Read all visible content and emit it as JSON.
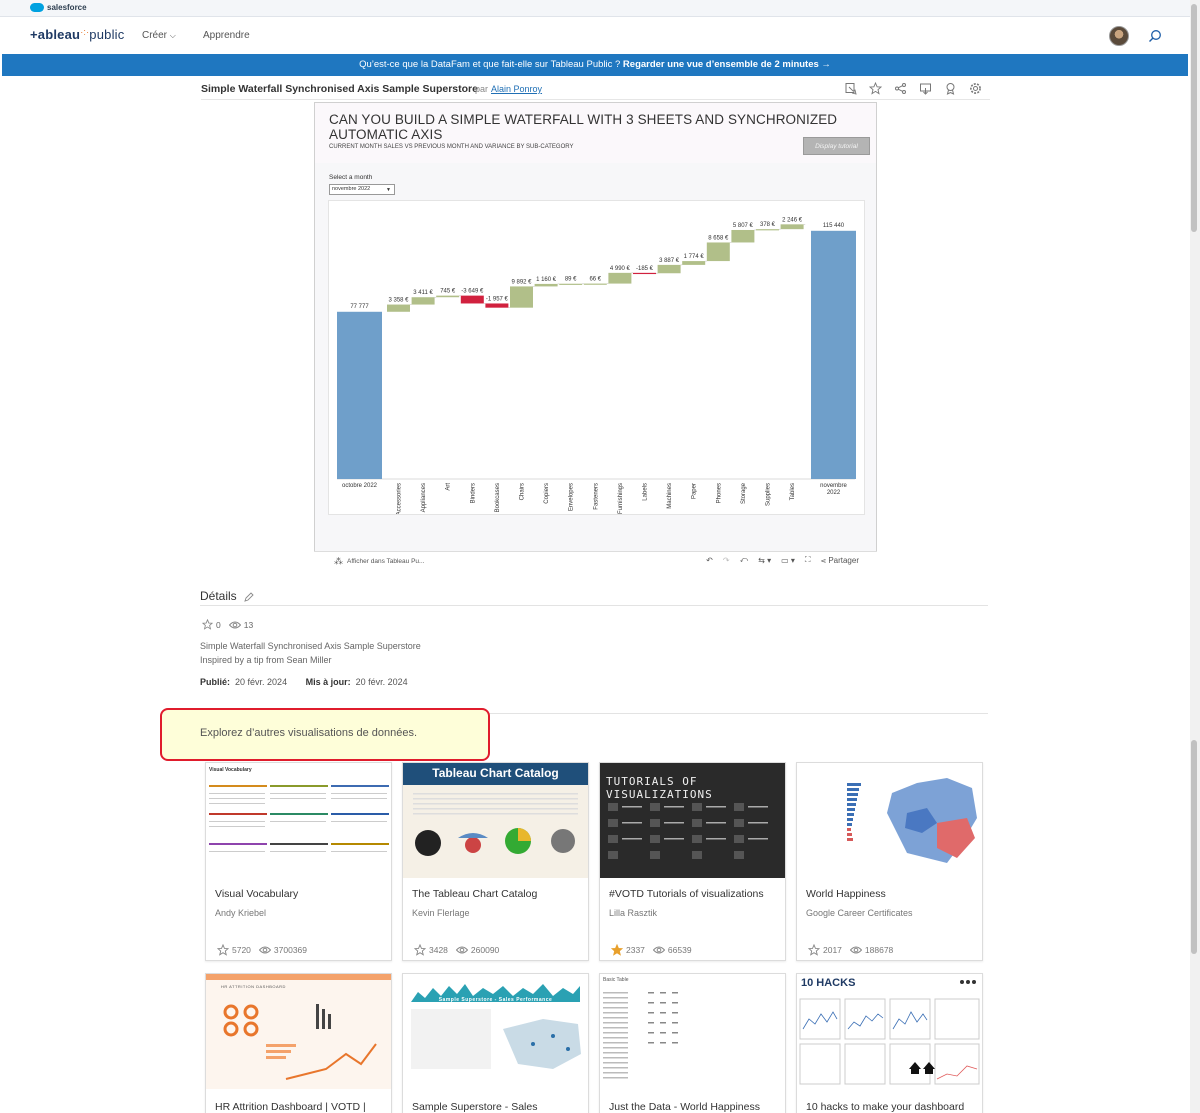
{
  "salesforce": {
    "label": "salesforce"
  },
  "nav": {
    "logo_pre": "+ableau",
    "logo_post": "public",
    "creer": "Créer",
    "apprendre": "Apprendre"
  },
  "banner": {
    "text": "Qu’est-ce que la DataFam et que fait-elle sur Tableau Public ? ",
    "link": "Regarder une vue d’ensemble de 2 minutes →"
  },
  "viz": {
    "title": "Simple Waterfall Synchronised Axis Sample Superstore",
    "par": "par",
    "author": "Alain Ponroy"
  },
  "dashboard": {
    "heading": "CAN YOU BUILD A SIMPLE WATERFALL WITH 3 SHEETS AND SYNCHRONIZED AUTOMATIC AXIS",
    "subheading": "CURRENT MONTH SALES VS PREVIOUS MONTH AND VARIANCE BY SUB-CATEGORY",
    "tutorial_button": "Display tutorial",
    "select_label": "Select a month",
    "select_value": "novembre 2022"
  },
  "chart_data": {
    "type": "bar",
    "subtype": "waterfall",
    "start": {
      "label": "octobre 2022",
      "value": 77777,
      "value_label": "77 777"
    },
    "end": {
      "label": "novembre 2022",
      "value": 115440,
      "value_label": "115 440"
    },
    "categories": [
      "Accessories",
      "Appliances",
      "Art",
      "Binders",
      "Bookcases",
      "Chairs",
      "Copiers",
      "Envelopes",
      "Fasteners",
      "Furnishings",
      "Labels",
      "Machines",
      "Paper",
      "Phones",
      "Storage",
      "Supplies",
      "Tables"
    ],
    "values": [
      3358,
      3411,
      745,
      -3649,
      -1957,
      9892,
      1160,
      89,
      66,
      4990,
      -185,
      3887,
      1774,
      8658,
      5807,
      378,
      2246
    ],
    "value_labels": [
      "3 358 €",
      "3 411 €",
      "745 €",
      "-3 649 €",
      "-1 957 €",
      "9 892 €",
      "1 160 €",
      "89 €",
      "66 €",
      "4 990 €",
      "-185 €",
      "3 887 €",
      "1 774 €",
      "8 658 €",
      "5 807 €",
      "378 €",
      "2 246 €"
    ],
    "colors": {
      "total": "#6f9fca",
      "positive": "#b1bf89",
      "negative": "#d1213e"
    },
    "ylim": [
      0,
      120000
    ]
  },
  "viz_toolbar": {
    "open": "Afficher dans Tableau Pu...",
    "share": "Partager"
  },
  "details": {
    "title": "Détails",
    "favorites": "0",
    "views": "13",
    "desc1": "Simple Waterfall Synchronised Axis Sample Superstore",
    "desc2": "Inspired by a tip from Sean Miller",
    "published_label": "Publié:",
    "published": "20 févr. 2024",
    "updated_label": "Mis à jour:",
    "updated": "20 févr. 2024"
  },
  "explore": {
    "text": "Explorez d’autres visualisations de données."
  },
  "cards": [
    {
      "title": "Visual Vocabulary",
      "author": "Andy Kriebel",
      "favorites": "5720",
      "views": "3700369",
      "starred": false
    },
    {
      "title": "The Tableau Chart Catalog",
      "author": "Kevin Flerlage",
      "favorites": "3428",
      "views": "260090",
      "starred": false
    },
    {
      "title": "#VOTD Tutorials of visualizations",
      "author": "Lilla Rasztik",
      "favorites": "2337",
      "views": "66539",
      "starred": true
    },
    {
      "title": "World Happiness",
      "author": "Google Career Certificates",
      "favorites": "2017",
      "views": "188678",
      "starred": false
    },
    {
      "title": "HR Attrition Dashboard | VOTD |"
    },
    {
      "title": "Sample Superstore - Sales"
    },
    {
      "title": "Just the Data - World Happiness"
    },
    {
      "title": "10 hacks to make your dashboard"
    }
  ],
  "thumbs": {
    "chart_catalog_title": "Tableau Chart Catalog",
    "votd_title": "TUTORIALS OF VISUALIZATIONS",
    "hacks_title": "10 HACKS",
    "vocab_title": "Visual Vocabulary",
    "superstore_title": "Sample Superstore - Sales Performance",
    "basic_table": "Basic Table",
    "hr_title": "HR ATTRITION DASHBOARD"
  }
}
